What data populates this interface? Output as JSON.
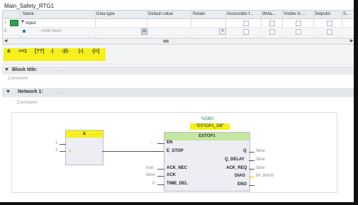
{
  "block_title_bar": "Main_Safety_RTG1",
  "grid": {
    "columns": [
      "Name",
      "Data type",
      "Default value",
      "Retain",
      "Accessible f...",
      "Writa...",
      "Visible in ...",
      "Setpoint",
      "S..."
    ],
    "rows": [
      {
        "num": "1",
        "name": "Input"
      },
      {
        "num": "2",
        "name": "<Add new>"
      }
    ]
  },
  "toolbar": {
    "buttons": [
      "&",
      ">=1",
      "[??]",
      "-|",
      "-|/|-",
      "|-|",
      "-[=]"
    ]
  },
  "block_title": {
    "label": "Block title:",
    "dots": "....",
    "comment": "Comment"
  },
  "network": {
    "label": "Network 1:",
    "dots": "....",
    "comment": "Comment"
  },
  "diagram": {
    "and_label": "&",
    "and_inputs": [
      "1",
      "1"
    ],
    "instance_number": "%DB3",
    "instance_name": "\"ESTOP1_DB\"",
    "fb_name": "ESTOP1",
    "en_value": "...",
    "inputs": [
      {
        "pin": "EN",
        "value": "..."
      },
      {
        "pin": "E_STOP",
        "value": ""
      },
      {
        "pin": "ACK_NEC",
        "value": "true"
      },
      {
        "pin": "ACK",
        "value": "false"
      },
      {
        "pin": "TIME_DEL",
        "value": "0"
      }
    ],
    "outputs": [
      {
        "pin": "Q",
        "value": "false"
      },
      {
        "pin": "Q_DELAY",
        "value": "false"
      },
      {
        "pin": "ACK_REQ",
        "value": "false"
      },
      {
        "pin": "DIAG",
        "value": "8# 16#00"
      },
      {
        "pin": "ENO",
        "value": ""
      }
    ]
  }
}
